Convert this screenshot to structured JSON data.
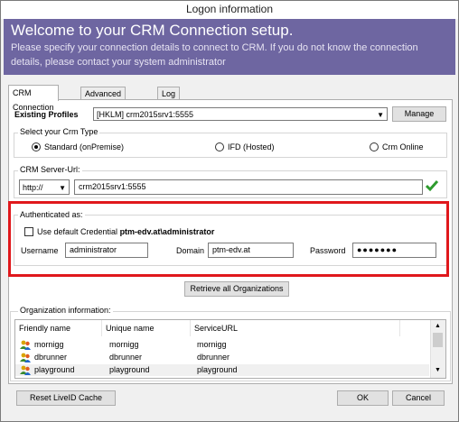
{
  "window": {
    "title": "Logon information"
  },
  "banner": {
    "heading": "Welcome to your CRM Connection setup.",
    "text": "Please specify your connection details to connect to CRM. If you do not know the connection details, please contact your system administrator",
    "bg_color": "#6e66a1"
  },
  "tabs": [
    {
      "label": "CRM Connection",
      "active": true
    },
    {
      "label": "Advanced Settings",
      "active": false
    },
    {
      "label": "Log",
      "active": false
    }
  ],
  "profiles": {
    "label": "Existing Profiles",
    "selected": "[HKLM] crm2015srv1:5555",
    "manage_label": "Manage"
  },
  "crm_type": {
    "legend": "Select your Crm Type",
    "options": [
      {
        "label": "Standard (onPremise)",
        "selected": true
      },
      {
        "label": "IFD (Hosted)",
        "selected": false
      },
      {
        "label": "Crm Online",
        "selected": false
      }
    ]
  },
  "server": {
    "legend": "CRM Server-Url:",
    "protocol": "http://",
    "url": "crm2015srv1:5555",
    "check_icon": "green-check-icon"
  },
  "auth": {
    "legend": "Authenticated as:",
    "default_label": "Use default Credential ",
    "default_account": "ptm-edv.at\\administrator",
    "username_label": "Username",
    "username": "administrator",
    "domain_label": "Domain",
    "domain": "ptm-edv.at",
    "password_label": "Password",
    "password": "●●●●●●●",
    "highlight_color": "#e0181c"
  },
  "retrieve_label": "Retrieve all Organizations",
  "org": {
    "legend": "Organization information:",
    "columns": [
      "Friendly name",
      "Unique name",
      "ServiceURL"
    ],
    "rows": [
      [
        "mornigg",
        "mornigg",
        "mornigg"
      ],
      [
        "dbrunner",
        "dbrunner",
        "dbrunner"
      ],
      [
        "playground",
        "playground",
        "playground"
      ]
    ]
  },
  "footer": {
    "reset_label": "Reset LiveID Cache",
    "ok_label": "OK",
    "cancel_label": "Cancel"
  }
}
